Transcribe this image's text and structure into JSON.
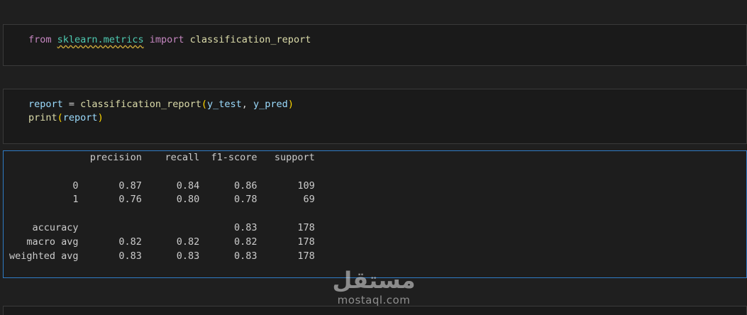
{
  "cells": {
    "cell1": {
      "kw_from": "from",
      "module": "sklearn.metrics",
      "kw_import": "import",
      "name": "classification_report"
    },
    "cell2": {
      "line1": {
        "var": "report",
        "eq": " = ",
        "fn": "classification_report",
        "open": "(",
        "arg1": "y_test",
        "sep": ", ",
        "arg2": "y_pred",
        "close": ")"
      },
      "line2": {
        "fn": "print",
        "open": "(",
        "arg": "report",
        "close": ")"
      }
    }
  },
  "output": {
    "lines": [
      "              precision    recall  f1-score   support",
      "",
      "           0       0.87      0.84      0.86       109",
      "           1       0.76      0.80      0.78        69",
      "",
      "    accuracy                           0.83       178",
      "   macro avg       0.82      0.82      0.82       178",
      "weighted avg       0.83      0.83      0.83       178"
    ]
  },
  "watermark": {
    "arabic": "مستقل",
    "latin": "mostaql.com"
  }
}
